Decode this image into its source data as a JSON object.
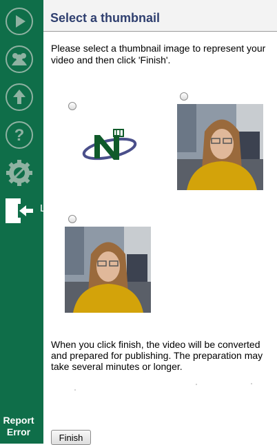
{
  "sidebar": {
    "icons": [
      "play-icon",
      "users-icon",
      "upload-icon",
      "help-icon",
      "settings-icon",
      "exit-icon"
    ],
    "stray_letter": "L",
    "report_error_label": "Report Error",
    "background": "#0f6e49"
  },
  "header": {
    "title": "Select a thumbnail"
  },
  "main": {
    "intro": "Please select a thumbnail image to represent your video and then click 'Finish'.",
    "thumbnails": [
      {
        "icon": "logo-n-icon",
        "selected": false
      },
      {
        "icon": "person-photo-icon",
        "selected": false
      },
      {
        "icon": "person-photo-icon",
        "selected": false
      }
    ],
    "footer": "When you click finish, the video will be converted and prepared for publishing. The preparation may take several minutes or longer.",
    "finish_label": "Finish"
  },
  "colors": {
    "accent_green": "#0f6e49",
    "title_blue": "#2f3f6f",
    "header_bg": "#f3f3f3"
  }
}
